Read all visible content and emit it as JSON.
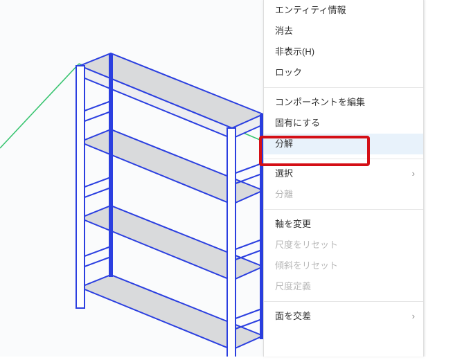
{
  "menu": {
    "items": [
      {
        "label": "エンティティ情報"
      },
      {
        "label": "消去"
      },
      {
        "label": "非表示(H)"
      },
      {
        "label": "ロック"
      },
      {
        "label": "コンポーネントを編集"
      },
      {
        "label": "固有にする"
      },
      {
        "label": "分解"
      },
      {
        "label": "選択"
      },
      {
        "label": "分離"
      },
      {
        "label": "軸を変更"
      },
      {
        "label": "尺度をリセット"
      },
      {
        "label": "傾斜をリセット"
      },
      {
        "label": "尺度定義"
      },
      {
        "label": "面を交差"
      }
    ]
  }
}
